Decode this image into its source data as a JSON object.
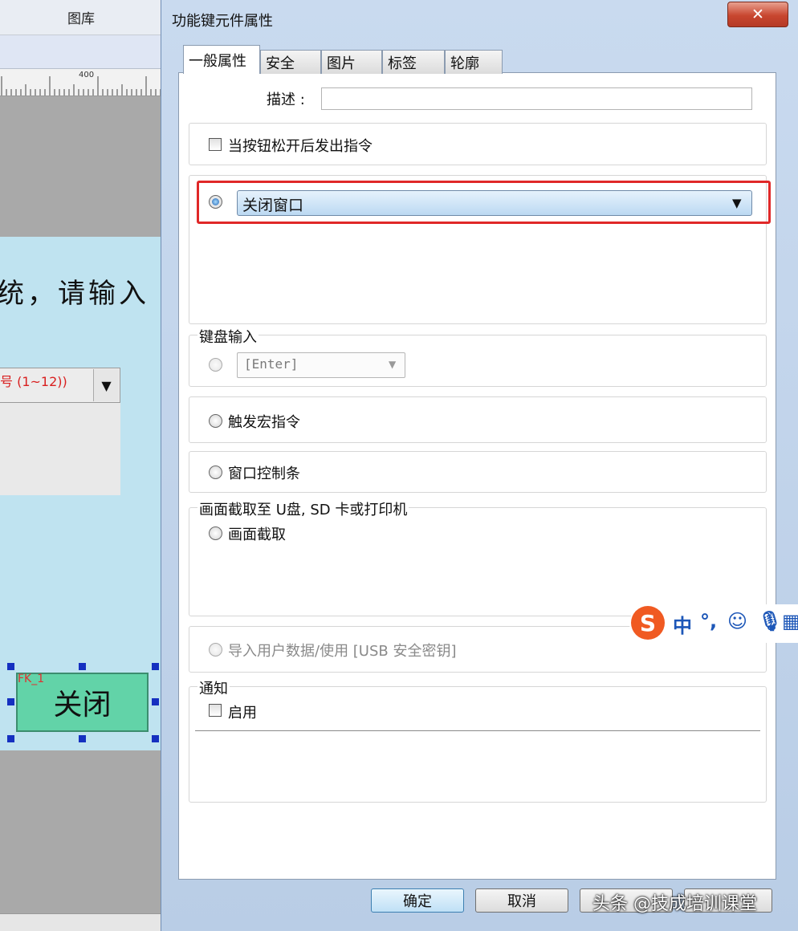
{
  "background_editor": {
    "library_label": "图库",
    "ruler_mark": "400",
    "screen_text": "统，请输入",
    "combo_text": "号 (1~12))",
    "close_button_label": "关闭",
    "close_button_id": "FK_1"
  },
  "dialog": {
    "title": "功能键元件属性",
    "tabs": [
      "一般属性",
      "安全",
      "图片",
      "标签",
      "轮廓"
    ],
    "description_label": "描述 :",
    "description_value": "",
    "on_release_label": "当按钮松开后发出指令",
    "action_select_value": "关闭窗口",
    "keyboard_group_title": "键盘输入",
    "keyboard_value": "[Enter]",
    "macro_label": "触发宏指令",
    "window_bar_label": "窗口控制条",
    "capture_group_title": "画面截取至 U盘, SD 卡或打印机",
    "capture_label": "画面截取",
    "import_label": "导入用户数据/使用 [USB 安全密钥]",
    "notify_group_title": "通知",
    "notify_enable_label": "启用",
    "buttons": {
      "ok": "确定",
      "cancel": "取消"
    }
  },
  "ime_toolbar": {
    "logo": "S",
    "lang": "中",
    "punct": "°,"
  },
  "watermark": "头条 @技成培训课堂",
  "colors": {
    "highlight": "#e02828",
    "screen_bg": "#bfe3f0",
    "button_bg": "#62d3a8"
  }
}
